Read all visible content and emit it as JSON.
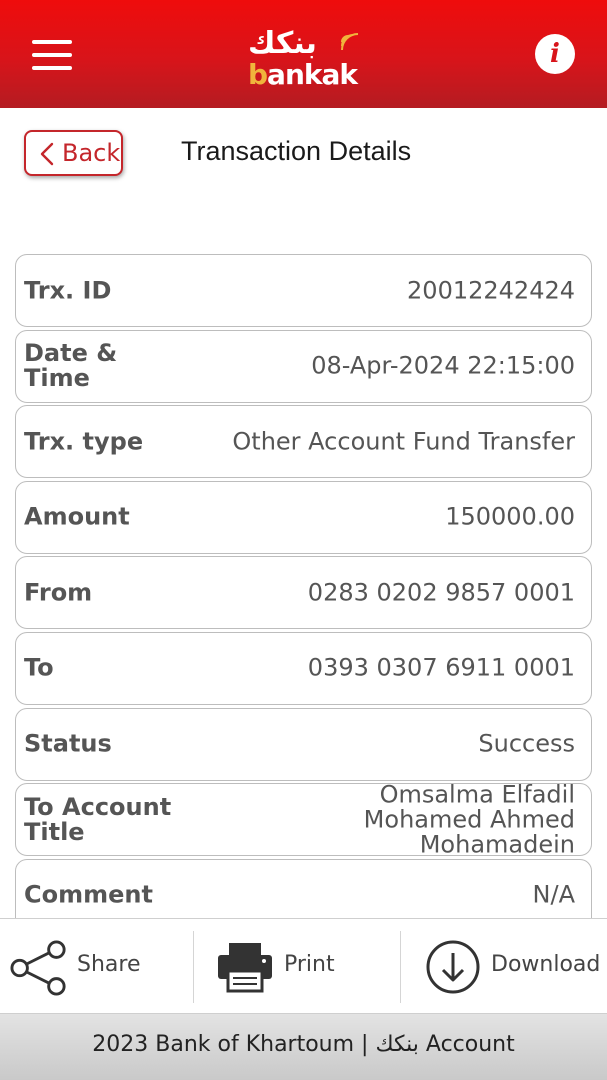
{
  "header": {
    "logo_arabic": "بنكك",
    "logo_latin_first": "b",
    "logo_latin_rest": "ankak",
    "info_label": "i",
    "brand_color": "#d8141a",
    "logo_accent_color": "#f0b43c"
  },
  "nav": {
    "back_label": "Back",
    "title": "Transaction Details"
  },
  "details": [
    {
      "label": "Trx. ID",
      "value": "20012242424"
    },
    {
      "label": "Date & Time",
      "value": "08-Apr-2024 22:15:00"
    },
    {
      "label": "Trx. type",
      "value": "Other Account Fund Transfer"
    },
    {
      "label": "Amount",
      "value": "150000.00"
    },
    {
      "label": "From",
      "value": "0283 0202 9857 0001"
    },
    {
      "label": "To",
      "value": "0393 0307 6911 0001"
    },
    {
      "label": "Status",
      "value": "Success"
    },
    {
      "label": "To Account Title",
      "value": "Omsalma Elfadil Mohamed Ahmed Mohamadein"
    },
    {
      "label": "Comment",
      "value": "N/A"
    }
  ],
  "actions": {
    "share_label": "Share",
    "print_label": "Print",
    "download_label": "Download"
  },
  "footer": {
    "text": "2023 Bank of Khartoum | بنكك Account"
  }
}
